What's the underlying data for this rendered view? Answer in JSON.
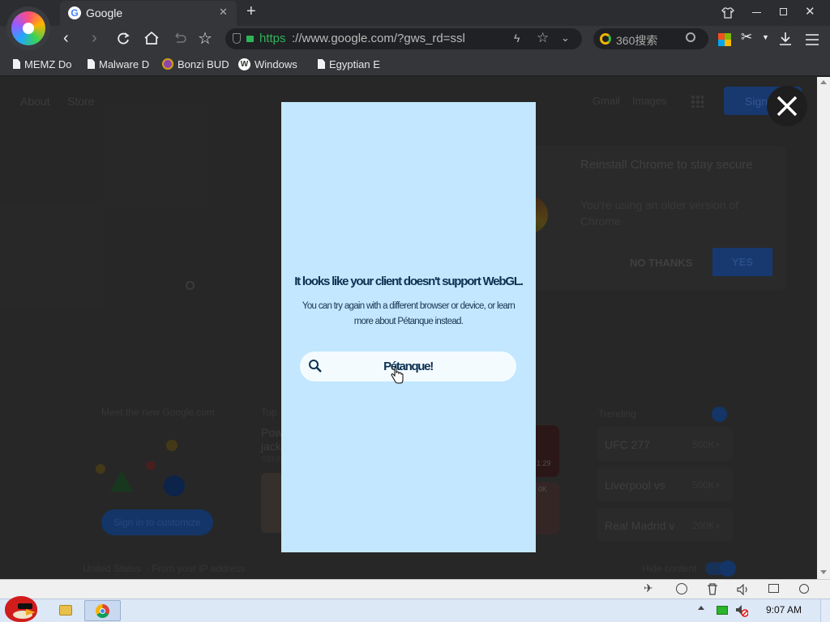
{
  "browser": {
    "tab_title": "Google",
    "url_https": "https",
    "url_rest": "://www.google.com/?gws_rd=ssl",
    "search_placeholder": "360搜索"
  },
  "bookmarks": [
    {
      "label": "MEMZ Do"
    },
    {
      "label": "Malware D"
    },
    {
      "label": "Bonzi BUD"
    },
    {
      "label": "Windows"
    },
    {
      "label": "Egyptian E"
    }
  ],
  "google": {
    "about": "About",
    "store": "Store",
    "gmail": "Gmail",
    "images": "Images",
    "sign_in": "Sign in",
    "promo_title": "Reinstall Chrome to stay secure",
    "promo_body": "You're using an older version of Chrome",
    "no_thanks": "NO THANKS",
    "yes": "YES",
    "meet_new": "Meet the new Google.com",
    "sign_in_customize": "Sign in to customize",
    "top_label": "Top",
    "top_story": "Pow jack",
    "top_source": "SBNK",
    "thumb_badge_1": "1:29",
    "thumb_badge_2": "0K",
    "trending_label": "Trending",
    "trending": [
      {
        "name": "UFC 277",
        "count": "500K+"
      },
      {
        "name": "Liverpool vs",
        "count": "500K+"
      },
      {
        "name": "Real Madrid v",
        "count": "200K+"
      }
    ],
    "location": "United States",
    "location_detail": "· From your IP address",
    "hide_content": "Hide content"
  },
  "modal": {
    "title": "It looks like your client doesn't support WebGL.",
    "body": "You can try again with a different browser or device, or learn more about Pétanque instead.",
    "search_label": "Pétanque!"
  },
  "taskbar": {
    "time": "9:07 AM"
  },
  "colors": {
    "modal_bg": "#c2e7ff",
    "modal_text": "#0c3151",
    "url_green": "#2fb35a",
    "sign_in_blue": "#1a3e7a"
  }
}
